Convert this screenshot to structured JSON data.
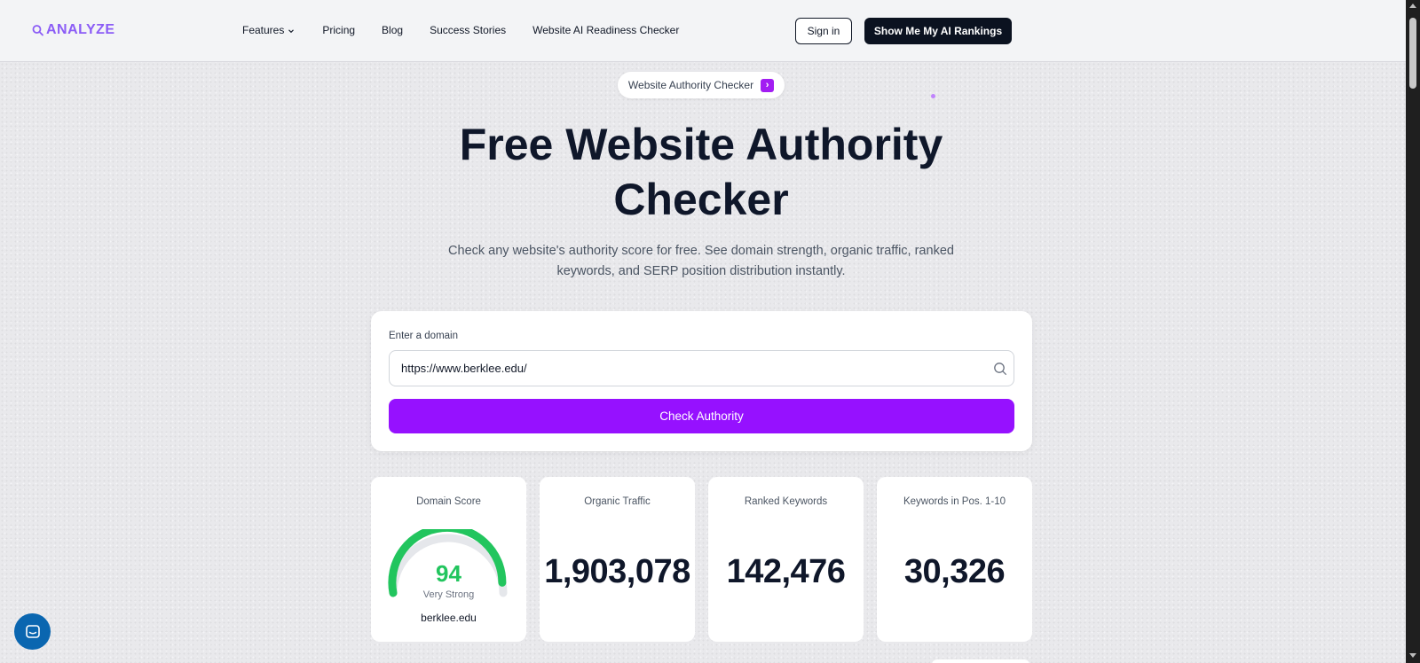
{
  "nav": {
    "logo_text": "ANALYZE",
    "links": [
      "Features",
      "Pricing",
      "Blog",
      "Success Stories",
      "Website AI Readiness Checker"
    ],
    "signin_label": "Sign in",
    "cta_label": "Show Me My AI Rankings"
  },
  "badge": {
    "label": "Website Authority Checker"
  },
  "hero": {
    "title": "Free Website Authority Checker",
    "subtitle": "Check any website's authority score for free. See domain strength, organic traffic, ranked keywords, and SERP position distribution instantly."
  },
  "form": {
    "label": "Enter a domain",
    "value": "https://www.berklee.edu/",
    "button_label": "Check Authority"
  },
  "stats": {
    "domain_score": {
      "label": "Domain Score",
      "value": "94",
      "score_fraction": 0.94,
      "rating": "Very Strong",
      "domain": "berklee.edu"
    },
    "organic_traffic": {
      "label": "Organic Traffic",
      "value": "1,903,078"
    },
    "ranked_keywords": {
      "label": "Ranked Keywords",
      "value": "142,476"
    },
    "top10_keywords": {
      "label": "Keywords in Pos. 1-10",
      "value": "30,326"
    }
  },
  "colors": {
    "brand": "#8b5cf6",
    "cta_purple": "#9611ff",
    "gauge_green": "#22c55e",
    "dark_button": "#0b1220",
    "chat_blue": "#0a66b0"
  },
  "icons": [
    "logo-icon",
    "chevron-down-icon",
    "chevron-right-icon",
    "search-icon",
    "chat-icon"
  ]
}
